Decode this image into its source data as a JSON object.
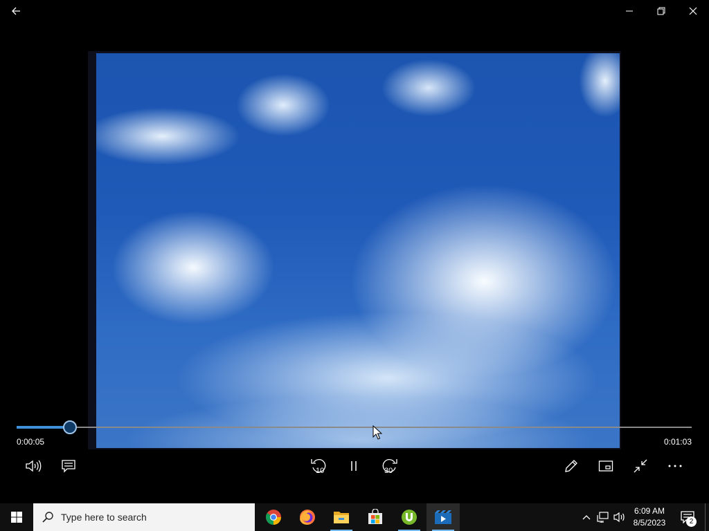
{
  "window": {
    "back_icon": "arrow-left-icon",
    "minimize_icon": "minimize-icon",
    "restore_icon": "restore-icon",
    "close_icon": "close-icon"
  },
  "player": {
    "current_time": "0:00:05",
    "total_time": "0:01:03",
    "progress_fraction": 0.0794,
    "accent_color": "#3f90d8",
    "controls": {
      "volume_icon": "volume-icon",
      "subtitles_icon": "subtitles-icon",
      "skip_back_label": "10",
      "pause_icon": "pause-icon",
      "skip_forward_label": "30",
      "edit_icon": "pencil-icon",
      "mini_view_icon": "mini-view-icon",
      "exit_fullscreen_icon": "exit-fullscreen-icon",
      "more_icon": "more-icon"
    }
  },
  "taskbar": {
    "search_placeholder": "Type here to search",
    "apps": [
      {
        "name": "Google Chrome",
        "icon": "chrome-icon"
      },
      {
        "name": "Firefox",
        "icon": "firefox-icon"
      },
      {
        "name": "File Explorer",
        "icon": "file-explorer-icon"
      },
      {
        "name": "Microsoft Store",
        "icon": "store-icon"
      },
      {
        "name": "uTorrent",
        "icon": "utorrent-icon"
      },
      {
        "name": "Movies & TV",
        "icon": "movies-tv-icon"
      }
    ],
    "clock_time": "6:09 AM",
    "clock_date": "8/5/2023",
    "notification_count": "2"
  }
}
